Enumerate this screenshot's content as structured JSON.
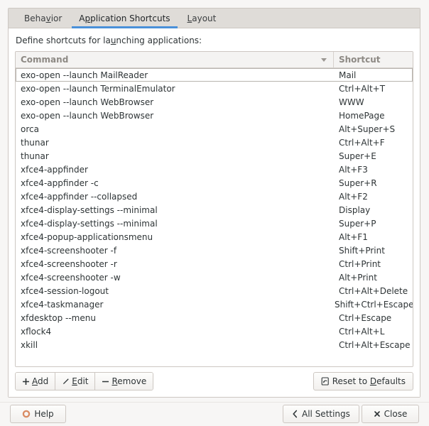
{
  "window": {
    "background": "#f7f6f5",
    "accent": "#4a90d9"
  },
  "tabs": [
    {
      "id": "behavior",
      "label": "Behavior",
      "mnemonic": "v",
      "active": false
    },
    {
      "id": "application-shortcuts",
      "label": "Application Shortcuts",
      "mnemonic": "p",
      "active": true
    },
    {
      "id": "layout",
      "label": "Layout",
      "mnemonic": "L",
      "active": false
    }
  ],
  "page": {
    "description_pre": "Define shortcuts for la",
    "description_mnemonic": "u",
    "description_post": "nching applications:"
  },
  "table": {
    "columns": [
      {
        "id": "command",
        "label": "Command",
        "sort_icon": "chevron-down-icon",
        "sorted": true
      },
      {
        "id": "shortcut",
        "label": "Shortcut",
        "sorted": false
      }
    ],
    "rows": [
      {
        "command": "exo-open --launch MailReader",
        "shortcut": "Mail",
        "focused": true
      },
      {
        "command": "exo-open --launch TerminalEmulator",
        "shortcut": "Ctrl+Alt+T",
        "focused": false
      },
      {
        "command": "exo-open --launch WebBrowser",
        "shortcut": "WWW",
        "focused": false
      },
      {
        "command": "exo-open --launch WebBrowser",
        "shortcut": "HomePage",
        "focused": false
      },
      {
        "command": "orca",
        "shortcut": "Alt+Super+S",
        "focused": false
      },
      {
        "command": "thunar",
        "shortcut": "Ctrl+Alt+F",
        "focused": false
      },
      {
        "command": "thunar",
        "shortcut": "Super+E",
        "focused": false
      },
      {
        "command": "xfce4-appfinder",
        "shortcut": "Alt+F3",
        "focused": false
      },
      {
        "command": "xfce4-appfinder -c",
        "shortcut": "Super+R",
        "focused": false
      },
      {
        "command": "xfce4-appfinder --collapsed",
        "shortcut": "Alt+F2",
        "focused": false
      },
      {
        "command": "xfce4-display-settings --minimal",
        "shortcut": "Display",
        "focused": false
      },
      {
        "command": "xfce4-display-settings --minimal",
        "shortcut": "Super+P",
        "focused": false
      },
      {
        "command": "xfce4-popup-applicationsmenu",
        "shortcut": "Alt+F1",
        "focused": false
      },
      {
        "command": "xfce4-screenshooter -f",
        "shortcut": "Shift+Print",
        "focused": false
      },
      {
        "command": "xfce4-screenshooter -r",
        "shortcut": "Ctrl+Print",
        "focused": false
      },
      {
        "command": "xfce4-screenshooter -w",
        "shortcut": "Alt+Print",
        "focused": false
      },
      {
        "command": "xfce4-session-logout",
        "shortcut": "Ctrl+Alt+Delete",
        "focused": false
      },
      {
        "command": "xfce4-taskmanager",
        "shortcut": "Shift+Ctrl+Escape",
        "focused": false
      },
      {
        "command": "xfdesktop --menu",
        "shortcut": "Ctrl+Escape",
        "focused": false
      },
      {
        "command": "xflock4",
        "shortcut": "Ctrl+Alt+L",
        "focused": false
      },
      {
        "command": "xkill",
        "shortcut": "Ctrl+Alt+Escape",
        "focused": false
      }
    ]
  },
  "toolbar": {
    "add": {
      "label_pre": "",
      "label_mnemonic": "A",
      "label_post": "dd",
      "icon": "plus-icon"
    },
    "edit": {
      "label_pre": "",
      "label_mnemonic": "E",
      "label_post": "dit",
      "icon": "pencil-icon"
    },
    "remove": {
      "label_pre": "",
      "label_mnemonic": "R",
      "label_post": "emove",
      "icon": "minus-icon"
    },
    "reset": {
      "label_pre": "Reset to ",
      "label_mnemonic": "D",
      "label_post": "efaults",
      "icon": "revert-icon"
    }
  },
  "actions": {
    "help": {
      "label": "Help",
      "icon": "help-ring-icon",
      "icon_color": "#d98b63"
    },
    "all_settings": {
      "label": "All Settings",
      "icon": "chevron-left-icon"
    },
    "close": {
      "label": "Close",
      "icon": "close-x-icon"
    }
  }
}
